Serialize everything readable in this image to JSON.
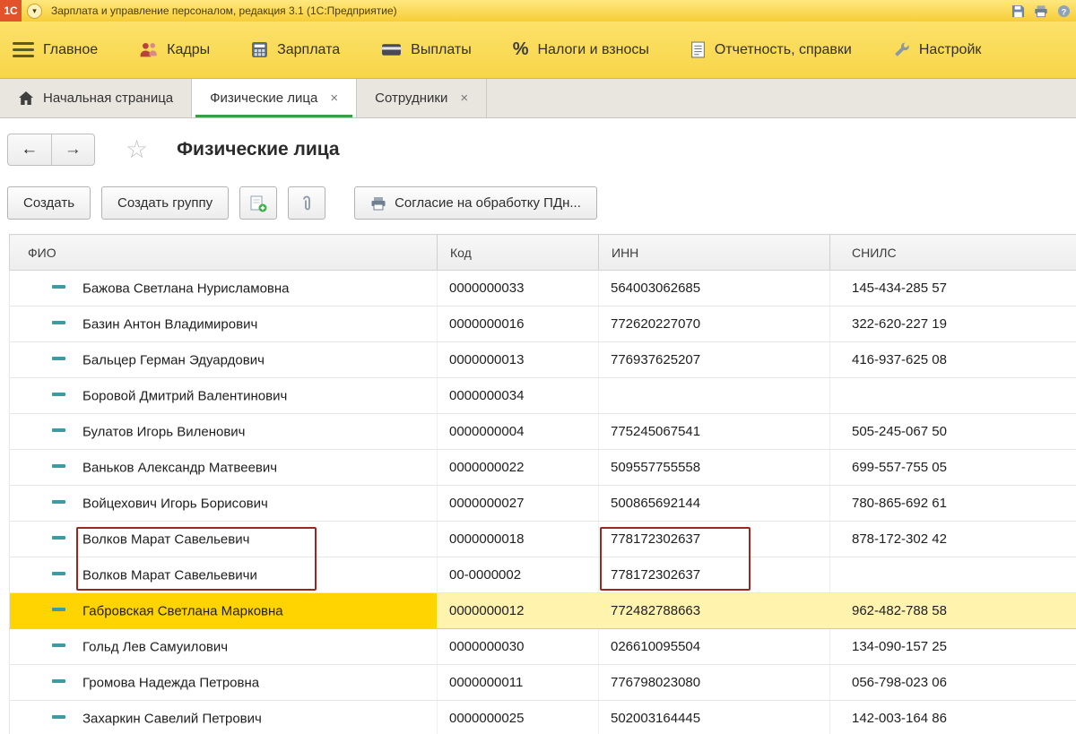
{
  "window": {
    "title": "Зарплата и управление персоналом, редакция 3.1  (1С:Предприятие)",
    "logo": "1С"
  },
  "ui": {
    "close_glyph": "×",
    "back_glyph": "←",
    "forward_glyph": "→",
    "star_glyph": "☆",
    "percent_glyph": "%",
    "dropdown_glyph": "▾"
  },
  "menu": {
    "items": [
      {
        "label": "Главное",
        "icon": "main-menu-icon"
      },
      {
        "label": "Кадры",
        "icon": "people-icon"
      },
      {
        "label": "Зарплата",
        "icon": "calculator-icon"
      },
      {
        "label": "Выплаты",
        "icon": "card-icon"
      },
      {
        "label": "Налоги и взносы",
        "icon": "percent-icon"
      },
      {
        "label": "Отчетность, справки",
        "icon": "report-icon"
      },
      {
        "label": "Настройк",
        "icon": "wrench-icon"
      }
    ]
  },
  "tabs": [
    {
      "label": "Начальная страница",
      "active": false
    },
    {
      "label": "Физические лица",
      "active": true
    },
    {
      "label": "Сотрудники",
      "active": false
    }
  ],
  "page": {
    "title": "Физические лица"
  },
  "toolbar": {
    "create": "Создать",
    "create_group": "Создать группу",
    "consent": "Согласие на обработку ПДн..."
  },
  "table": {
    "columns": [
      "ФИО",
      "Код",
      "ИНН",
      "СНИЛС"
    ],
    "rows": [
      {
        "fio": "Бажова Светлана Нурисламовна",
        "code": "0000000033",
        "inn": "564003062685",
        "snils": "145-434-285 57",
        "selected": false,
        "marked": false
      },
      {
        "fio": "Базин Антон Владимирович",
        "code": "0000000016",
        "inn": "772620227070",
        "snils": "322-620-227 19",
        "selected": false,
        "marked": false
      },
      {
        "fio": "Бальцер Герман Эдуардович",
        "code": "0000000013",
        "inn": "776937625207",
        "snils": "416-937-625 08",
        "selected": false,
        "marked": false
      },
      {
        "fio": "Боровой Дмитрий Валентинович",
        "code": "0000000034",
        "inn": "",
        "snils": "",
        "selected": false,
        "marked": false
      },
      {
        "fio": "Булатов Игорь Виленович",
        "code": "0000000004",
        "inn": "775245067541",
        "snils": "505-245-067 50",
        "selected": false,
        "marked": false
      },
      {
        "fio": "Ваньков Александр Матвеевич",
        "code": "0000000022",
        "inn": "509557755558",
        "snils": "699-557-755 05",
        "selected": false,
        "marked": false
      },
      {
        "fio": "Войцехович Игорь Борисович",
        "code": "0000000027",
        "inn": "500865692144",
        "snils": "780-865-692 61",
        "selected": false,
        "marked": false
      },
      {
        "fio": "Волков Марат Савельевич",
        "code": "0000000018",
        "inn": "778172302637",
        "snils": "878-172-302 42",
        "selected": false,
        "marked": true
      },
      {
        "fio": "Волков Марат Савельевичи",
        "code": "00-0000002",
        "inn": "778172302637",
        "snils": "",
        "selected": false,
        "marked": true
      },
      {
        "fio": "Габровская Светлана Марковна",
        "code": "0000000012",
        "inn": "772482788663",
        "snils": "962-482-788 58",
        "selected": true,
        "marked": false
      },
      {
        "fio": "Гольд Лев Самуилович",
        "code": "0000000030",
        "inn": "026610095504",
        "snils": "134-090-157 25",
        "selected": false,
        "marked": false
      },
      {
        "fio": "Громова Надежда Петровна",
        "code": "0000000011",
        "inn": "776798023080",
        "snils": "056-798-023 06",
        "selected": false,
        "marked": false
      },
      {
        "fio": "Захаркин Савелий Петрович",
        "code": "0000000025",
        "inn": "502003164445",
        "snils": "142-003-164 86",
        "selected": false,
        "marked": false
      }
    ]
  },
  "colors": {
    "titlebar": "#f8d243",
    "selected_row_fio": "#ffd400",
    "selected_row": "#fff3ae",
    "annotation": "#9e271d",
    "tab_active_underline": "#3a9e45"
  }
}
